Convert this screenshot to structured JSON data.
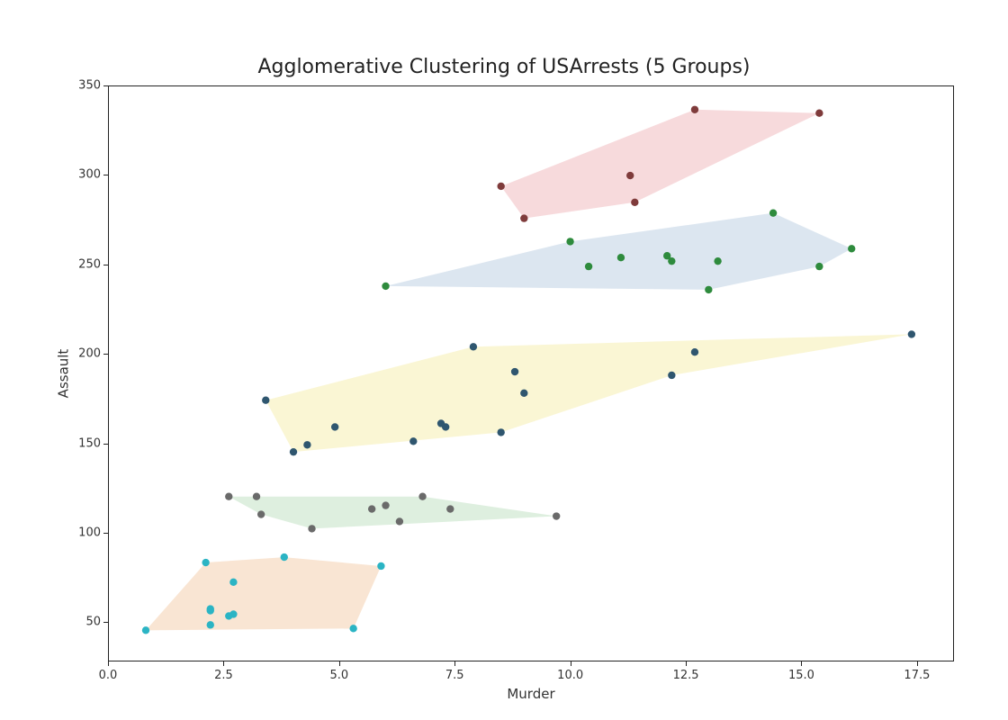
{
  "chart_data": {
    "type": "scatter",
    "title": "Agglomerative Clustering of USArrests (5 Groups)",
    "xlabel": "Murder",
    "ylabel": "Assault",
    "xlim": [
      0.0,
      18.3
    ],
    "ylim": [
      28,
      350
    ],
    "xticks": [
      0.0,
      2.5,
      5.0,
      7.5,
      10.0,
      12.5,
      15.0,
      17.5
    ],
    "yticks": [
      50,
      100,
      150,
      200,
      250,
      300,
      350
    ],
    "series": [
      {
        "name": "cluster-0-red",
        "color": "#7f3b3b",
        "hull_fill": "#f2c6c9",
        "points": [
          {
            "x": 8.5,
            "y": 294
          },
          {
            "x": 9.0,
            "y": 276
          },
          {
            "x": 11.3,
            "y": 300
          },
          {
            "x": 11.4,
            "y": 285
          },
          {
            "x": 12.7,
            "y": 337
          },
          {
            "x": 15.4,
            "y": 335
          }
        ],
        "hull": [
          {
            "x": 8.5,
            "y": 294
          },
          {
            "x": 12.7,
            "y": 337
          },
          {
            "x": 15.4,
            "y": 335
          },
          {
            "x": 11.4,
            "y": 285
          },
          {
            "x": 9.0,
            "y": 276
          }
        ]
      },
      {
        "name": "cluster-1-green",
        "color": "#2e8b3d",
        "hull_fill": "#c9d8e8",
        "points": [
          {
            "x": 6.0,
            "y": 238
          },
          {
            "x": 10.0,
            "y": 263
          },
          {
            "x": 10.4,
            "y": 249
          },
          {
            "x": 11.1,
            "y": 254
          },
          {
            "x": 12.1,
            "y": 255
          },
          {
            "x": 12.2,
            "y": 252
          },
          {
            "x": 13.0,
            "y": 236
          },
          {
            "x": 13.2,
            "y": 252
          },
          {
            "x": 14.4,
            "y": 279
          },
          {
            "x": 15.4,
            "y": 249
          },
          {
            "x": 16.1,
            "y": 259
          }
        ],
        "hull": [
          {
            "x": 6.0,
            "y": 238
          },
          {
            "x": 10.0,
            "y": 263
          },
          {
            "x": 14.4,
            "y": 279
          },
          {
            "x": 16.1,
            "y": 259
          },
          {
            "x": 15.4,
            "y": 249
          },
          {
            "x": 13.0,
            "y": 236
          }
        ]
      },
      {
        "name": "cluster-2-blue",
        "color": "#2f566f",
        "hull_fill": "#f7f1bd",
        "points": [
          {
            "x": 3.4,
            "y": 174
          },
          {
            "x": 4.0,
            "y": 145
          },
          {
            "x": 4.3,
            "y": 149
          },
          {
            "x": 4.9,
            "y": 159
          },
          {
            "x": 6.6,
            "y": 151
          },
          {
            "x": 7.2,
            "y": 161
          },
          {
            "x": 7.3,
            "y": 159
          },
          {
            "x": 7.9,
            "y": 204
          },
          {
            "x": 8.5,
            "y": 156
          },
          {
            "x": 8.8,
            "y": 190
          },
          {
            "x": 9.0,
            "y": 178
          },
          {
            "x": 12.2,
            "y": 188
          },
          {
            "x": 12.7,
            "y": 201
          },
          {
            "x": 17.4,
            "y": 211
          }
        ],
        "hull": [
          {
            "x": 3.4,
            "y": 174
          },
          {
            "x": 7.9,
            "y": 204
          },
          {
            "x": 17.4,
            "y": 211
          },
          {
            "x": 12.2,
            "y": 188
          },
          {
            "x": 8.5,
            "y": 156
          },
          {
            "x": 4.0,
            "y": 145
          }
        ]
      },
      {
        "name": "cluster-3-grey",
        "color": "#6a6a6a",
        "hull_fill": "#cde7ce",
        "points": [
          {
            "x": 2.6,
            "y": 120
          },
          {
            "x": 3.2,
            "y": 120
          },
          {
            "x": 3.3,
            "y": 110
          },
          {
            "x": 4.4,
            "y": 102
          },
          {
            "x": 5.7,
            "y": 113
          },
          {
            "x": 6.0,
            "y": 115
          },
          {
            "x": 6.3,
            "y": 106
          },
          {
            "x": 6.8,
            "y": 120
          },
          {
            "x": 7.4,
            "y": 113
          },
          {
            "x": 9.7,
            "y": 109
          }
        ],
        "hull": [
          {
            "x": 2.6,
            "y": 120
          },
          {
            "x": 6.8,
            "y": 120
          },
          {
            "x": 9.7,
            "y": 109
          },
          {
            "x": 4.4,
            "y": 102
          },
          {
            "x": 3.3,
            "y": 110
          }
        ]
      },
      {
        "name": "cluster-4-cyan",
        "color": "#2bb4c4",
        "hull_fill": "#f6d7bb",
        "points": [
          {
            "x": 0.8,
            "y": 45
          },
          {
            "x": 2.1,
            "y": 83
          },
          {
            "x": 2.2,
            "y": 48
          },
          {
            "x": 2.2,
            "y": 56
          },
          {
            "x": 2.2,
            "y": 57
          },
          {
            "x": 2.6,
            "y": 53
          },
          {
            "x": 2.7,
            "y": 72
          },
          {
            "x": 2.7,
            "y": 54
          },
          {
            "x": 3.8,
            "y": 86
          },
          {
            "x": 5.3,
            "y": 46
          },
          {
            "x": 5.9,
            "y": 81
          }
        ],
        "hull": [
          {
            "x": 0.8,
            "y": 45
          },
          {
            "x": 2.1,
            "y": 83
          },
          {
            "x": 3.8,
            "y": 86
          },
          {
            "x": 5.9,
            "y": 81
          },
          {
            "x": 5.3,
            "y": 46
          }
        ]
      }
    ]
  }
}
